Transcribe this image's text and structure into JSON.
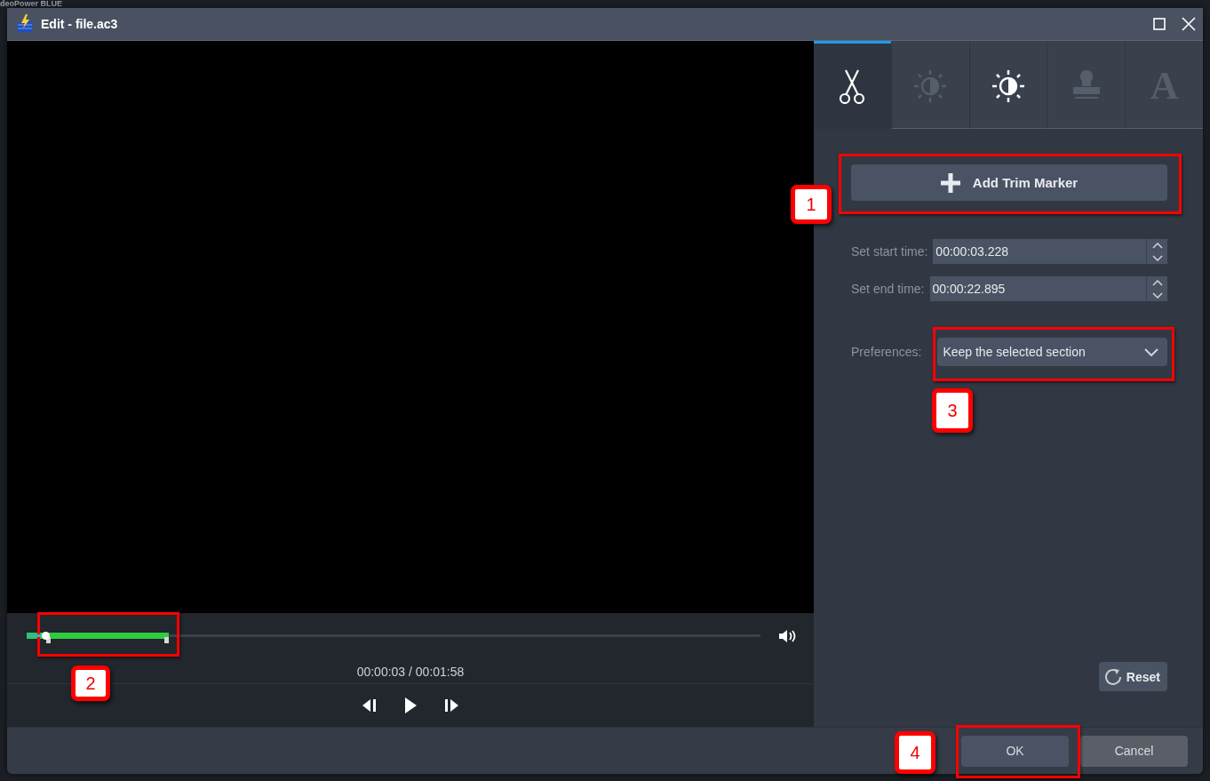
{
  "background_app": {
    "title": "deoPower BLUE"
  },
  "window": {
    "title": "Edit - file.ac3"
  },
  "tabs": [
    {
      "kind": "scissors",
      "selected": true,
      "disabled": false
    },
    {
      "kind": "brightness",
      "selected": false,
      "disabled": true
    },
    {
      "kind": "brightness",
      "selected": false,
      "disabled": false
    },
    {
      "kind": "stamp",
      "selected": false,
      "disabled": true
    },
    {
      "kind": "text",
      "glyph": "A",
      "selected": false,
      "disabled": true
    }
  ],
  "add_button": {
    "label": "Add Trim Marker"
  },
  "fields": [
    {
      "label": "Set start time:",
      "value": "00:00:03.228"
    },
    {
      "label": "Set end time:",
      "value": "00:00:22.895"
    }
  ],
  "preferences": {
    "label": "Preferences:",
    "value": "Keep the selected section"
  },
  "reset_button": {
    "label": "Reset"
  },
  "player": {
    "position": {
      "level": 0.026
    },
    "selection": {
      "start": {
        "level": 0.027
      },
      "end": {
        "level": 0.194
      }
    },
    "time": "00:00:03 / 00:01:58"
  },
  "buttons": [
    {
      "label": "OK",
      "default": true
    },
    {
      "label": "Cancel",
      "default": false
    }
  ],
  "callouts": [
    {
      "label": "1"
    },
    {
      "label": "2"
    },
    {
      "label": "3"
    },
    {
      "label": "4"
    }
  ]
}
